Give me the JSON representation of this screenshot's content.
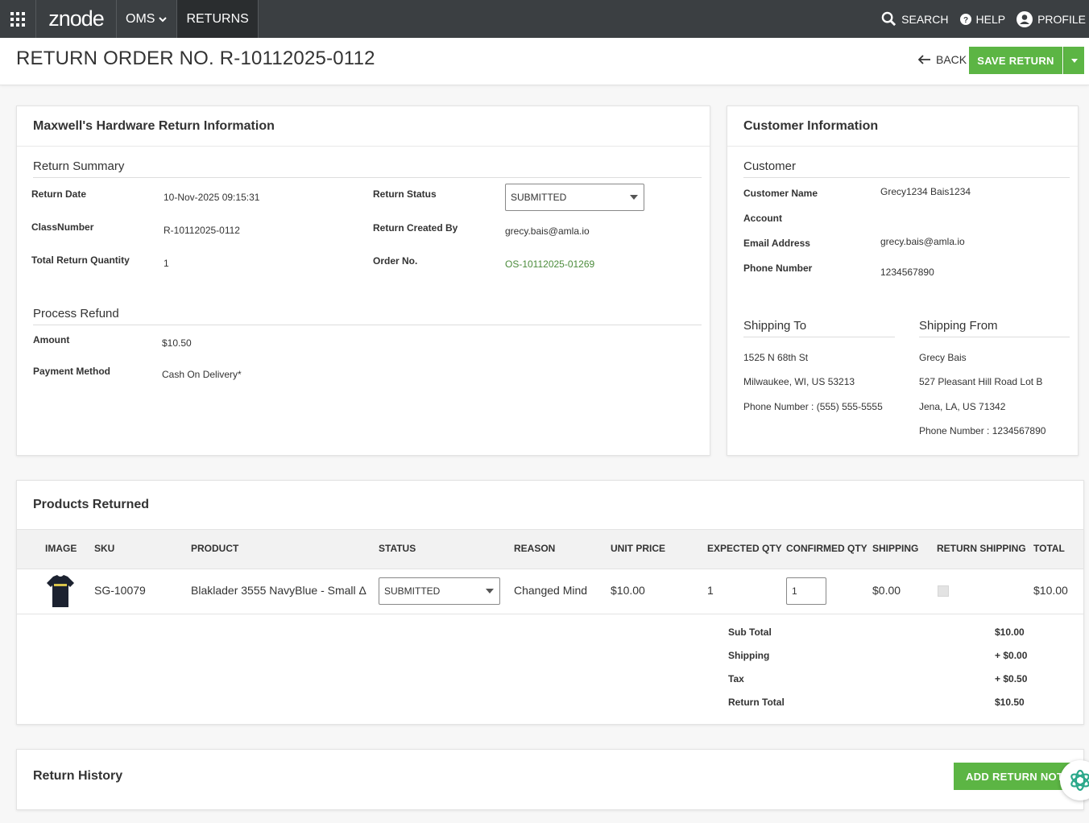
{
  "topbar": {
    "logo": "znode",
    "nav_oms": "OMS",
    "nav_returns": "RETURNS",
    "search": "SEARCH",
    "help": "HELP",
    "profile": "PROFILE"
  },
  "header": {
    "title": "RETURN ORDER NO. R-10112025-0112",
    "back": "BACK",
    "save": "SAVE RETURN"
  },
  "return_info": {
    "title": "Maxwell's Hardware Return Information",
    "summary_title": "Return Summary",
    "return_date_label": "Return Date",
    "return_date": "10-Nov-2025 09:15:31",
    "class_number_label": "ClassNumber",
    "class_number": "R-10112025-0112",
    "total_qty_label": "Total Return Quantity",
    "total_qty": "1",
    "status_label": "Return Status",
    "status": "SUBMITTED",
    "created_by_label": "Return Created By",
    "created_by": "grecy.bais@amla.io",
    "order_no_label": "Order No.",
    "order_no": "OS-10112025-01269",
    "refund_title": "Process Refund",
    "amount_label": "Amount",
    "amount": "$10.50",
    "payment_label": "Payment Method",
    "payment": "Cash On Delivery*"
  },
  "customer": {
    "title": "Customer Information",
    "section": "Customer",
    "name_label": "Customer Name",
    "name": "Grecy1234 Bais1234",
    "account_label": "Account",
    "email_label": "Email Address",
    "email": "grecy.bais@amla.io",
    "phone_label": "Phone Number",
    "phone": "1234567890",
    "ship_to_title": "Shipping To",
    "ship_to_line1": "1525 N 68th St",
    "ship_to_line2": "Milwaukee, WI, US 53213",
    "ship_to_phone": "Phone Number : (555) 555-5555",
    "ship_from_title": "Shipping From",
    "ship_from_name": "Grecy Bais",
    "ship_from_line1": "527 Pleasant Hill Road Lot B",
    "ship_from_line2": "Jena, LA, US 71342",
    "ship_from_phone": "Phone Number : 1234567890"
  },
  "products": {
    "title": "Products Returned",
    "headers": [
      "IMAGE",
      "SKU",
      "PRODUCT",
      "STATUS",
      "REASON",
      "UNIT PRICE",
      "EXPECTED QTY",
      "CONFIRMED QTY",
      "SHIPPING",
      "RETURN SHIPPING",
      "TOTAL"
    ],
    "row": {
      "sku": "SG-10079",
      "product": "Blaklader 3555 NavyBlue - Small Δ",
      "status": "SUBMITTED",
      "reason": "Changed Mind",
      "unit_price": "$10.00",
      "expected_qty": "1",
      "confirmed_qty": "1",
      "shipping": "$0.00",
      "total": "$10.00"
    },
    "totals": {
      "sub_total_label": "Sub Total",
      "sub_total": "$10.00",
      "shipping_label": "Shipping",
      "shipping": "+ $0.00",
      "tax_label": "Tax",
      "tax": "+ $0.50",
      "return_total_label": "Return Total",
      "return_total": "$10.50"
    }
  },
  "history": {
    "title": "Return History",
    "add_note": "ADD RETURN NOTE"
  },
  "colors": {
    "topbar": "#3b3f42",
    "accent_green": "#5cb544",
    "link_green": "#4b8b3b"
  }
}
